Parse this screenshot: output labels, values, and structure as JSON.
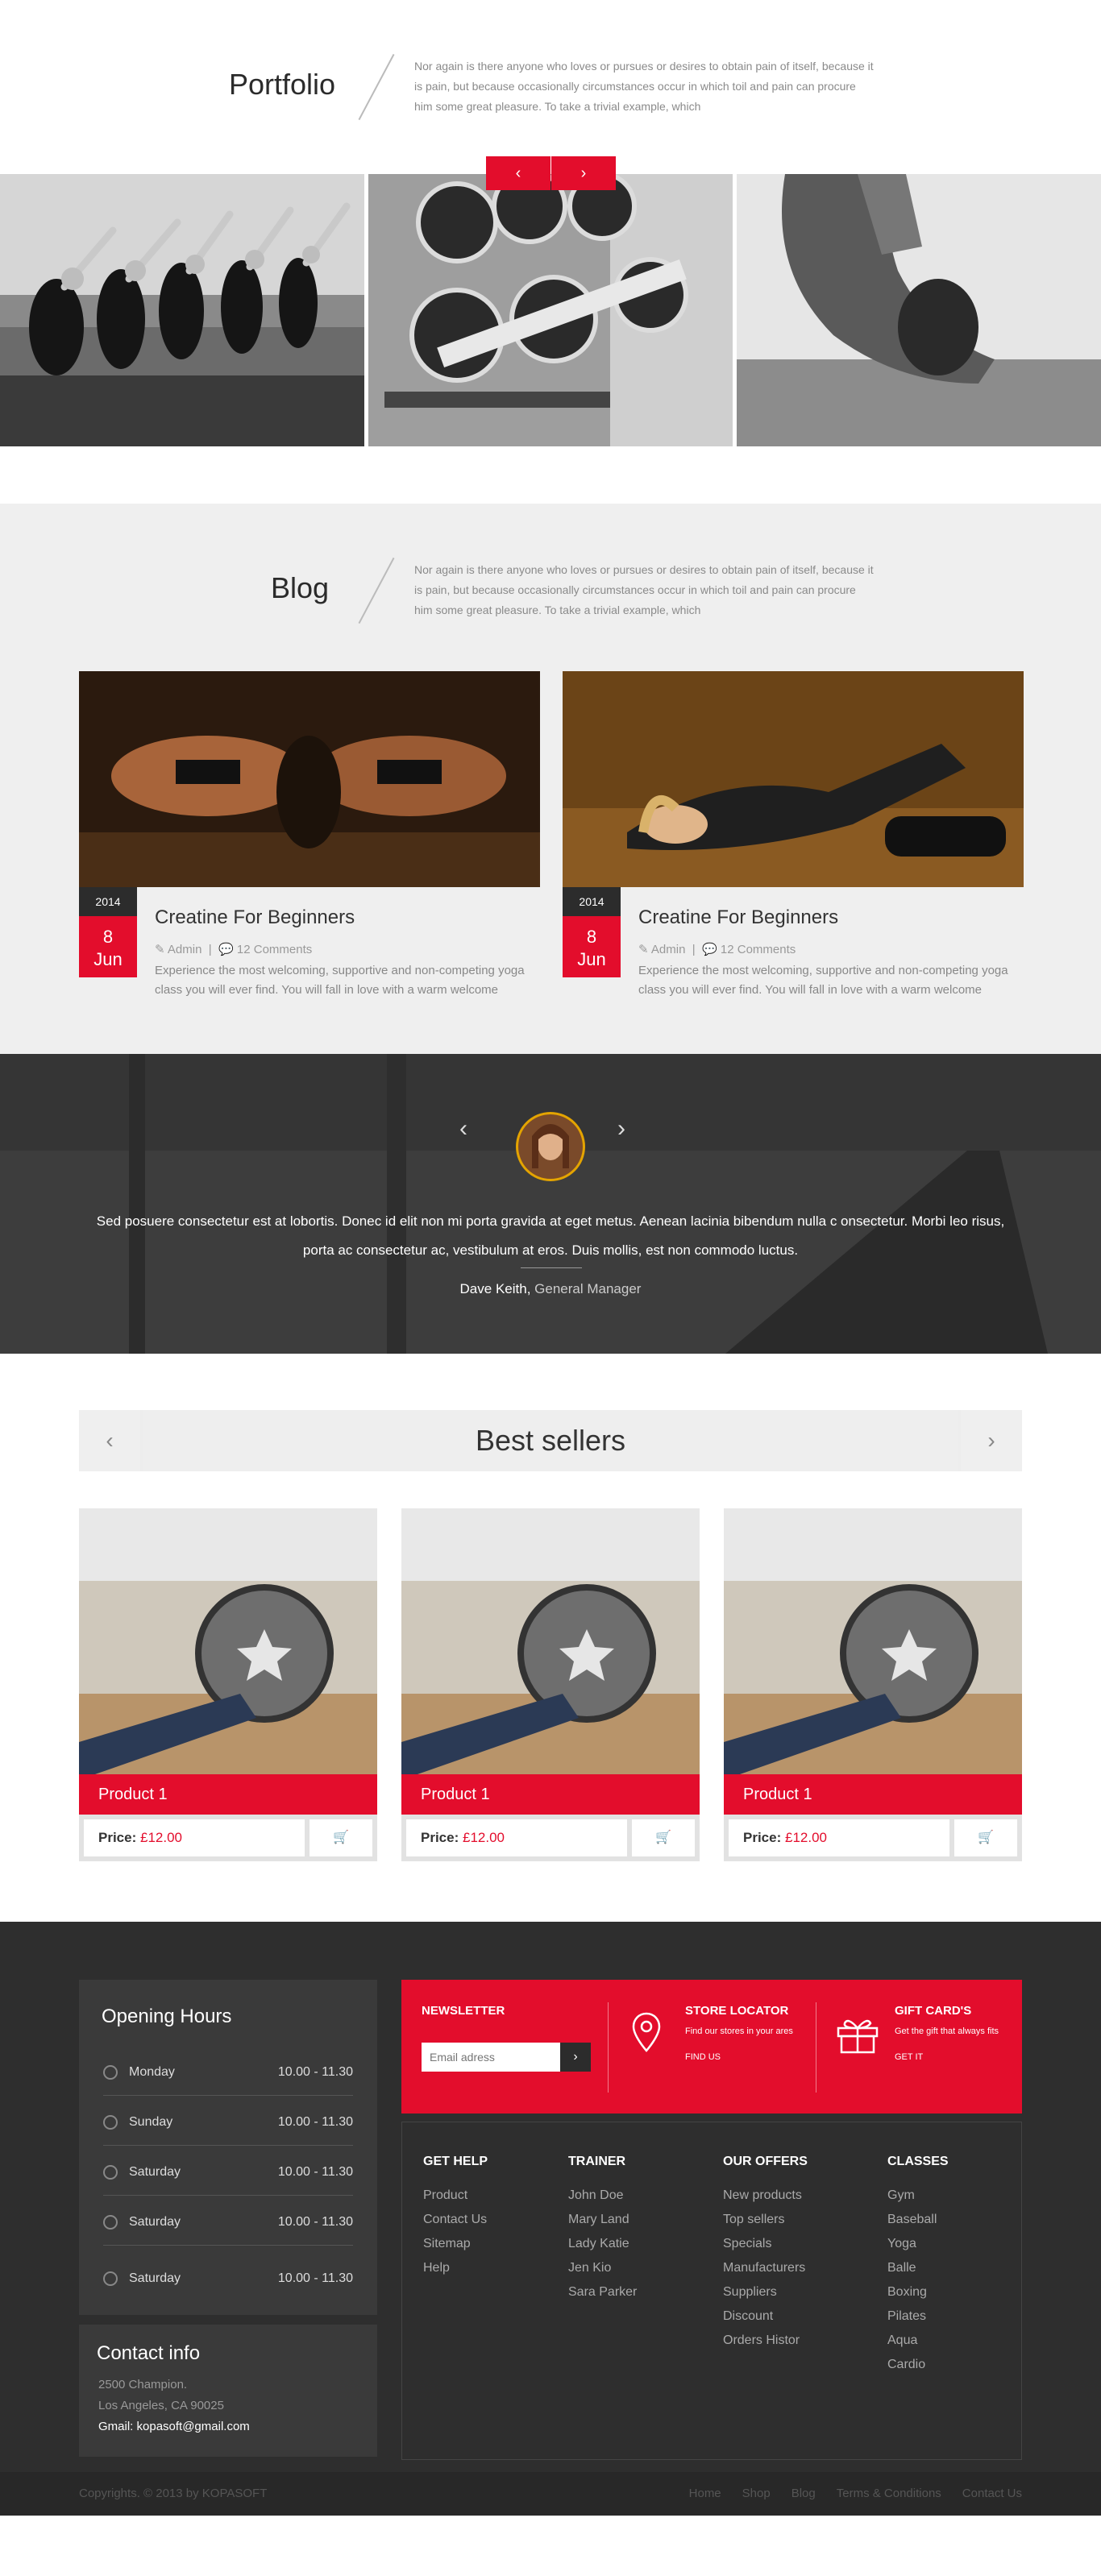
{
  "portfolio": {
    "title": "Portfolio",
    "intro": "Nor again is there anyone who loves or pursues or desires to obtain pain of itself, because it is pain, but because occasionally circumstances occur in which toil and pain can procure him some great pleasure. To take a trivial example, which",
    "prev_icon": "chevron-left-icon",
    "next_icon": "chevron-right-icon",
    "prev": "‹",
    "next": "›"
  },
  "blog": {
    "title": "Blog",
    "intro": "Nor again is there anyone who loves or pursues or desires to obtain pain of itself, because it is pain, but because occasionally circumstances occur in which toil and pain can procure him some great pleasure. To take a trivial example, which",
    "posts": [
      {
        "year": "2014",
        "day": "8",
        "month": "Jun",
        "title": "Creatine For Beginners",
        "author": "Admin",
        "comments": "12 Comments",
        "excerpt": "Experience the most welcoming, supportive and non-competing yoga class you will ever find. You will fall in love with a warm welcome"
      },
      {
        "year": "2014",
        "day": "8",
        "month": "Jun",
        "title": "Creatine For Beginners",
        "author": "Admin",
        "comments": "12 Comments",
        "excerpt": "Experience the most welcoming, supportive and non-competing yoga class you will ever find. You will fall in love with a warm welcome"
      }
    ]
  },
  "testimonial": {
    "quote": "Sed posuere consectetur est at lobortis. Donec id elit non mi porta gravida at eget metus. Aenean lacinia bibendum nulla c onsectetur. Morbi leo risus, porta ac consectetur ac, vestibulum at eros. Duis mollis, est non commodo luctus.",
    "author": "Dave Keith,",
    "role": "General Manager",
    "prev": "‹",
    "next": "›"
  },
  "bestsellers": {
    "title": "Best sellers",
    "prev": "‹",
    "next": "›",
    "products": [
      {
        "name": "Product 1",
        "price_label": "Price:",
        "price": "£12.00"
      },
      {
        "name": "Product 1",
        "price_label": "Price:",
        "price": "£12.00"
      },
      {
        "name": "Product 1",
        "price_label": "Price:",
        "price": "£12.00"
      }
    ]
  },
  "footer": {
    "opening_hours": {
      "title": "Opening Hours",
      "rows": [
        {
          "day": "Monday",
          "hours": "10.00 - 11.30"
        },
        {
          "day": "Sunday",
          "hours": "10.00 - 11.30"
        },
        {
          "day": "Saturday",
          "hours": "10.00 - 11.30"
        },
        {
          "day": "Saturday",
          "hours": "10.00 - 11.30"
        },
        {
          "day": "Saturday",
          "hours": "10.00 - 11.30"
        }
      ]
    },
    "contact": {
      "title": "Contact info",
      "address1": "2500 Champion.",
      "address2": "Los Angeles, CA 90025",
      "email": "Gmail: kopasoft@gmail.com"
    },
    "newsletter": {
      "title": "NEWSLETTER",
      "placeholder": "Email adress",
      "button": "›"
    },
    "store_locator": {
      "title": "STORE LOCATOR",
      "subtitle": "Find our stores in your ares",
      "link": "FIND US"
    },
    "gift_cards": {
      "title": "GIFT CARD'S",
      "subtitle": "Get the gift that always fits",
      "link": "GET IT"
    },
    "columns": [
      {
        "title": "GET HELP",
        "items": [
          "Product",
          "Contact Us",
          "Sitemap",
          "Help"
        ]
      },
      {
        "title": "TRAINER",
        "items": [
          "John Doe",
          "Mary Land",
          "Lady Katie",
          "Jen Kio",
          "Sara Parker"
        ]
      },
      {
        "title": "OUR OFFERS",
        "items": [
          "New products",
          "Top sellers",
          "Specials",
          "Manufacturers",
          "Suppliers",
          "Discount",
          "Orders Histor"
        ]
      },
      {
        "title": "CLASSES",
        "items": [
          "Gym",
          "Baseball",
          "Yoga",
          "Balle",
          "Boxing",
          "Pilates",
          "Aqua",
          "Cardio"
        ]
      }
    ],
    "copyright": "Copyrights. © 2013 by KOPASOFT",
    "nav": [
      "Home",
      "Shop",
      "Blog",
      "Terms & Conditions",
      "Contact Us"
    ]
  },
  "colors": {
    "accent": "#e30d2c",
    "dark": "#2e2e2e",
    "light": "#efefef"
  }
}
